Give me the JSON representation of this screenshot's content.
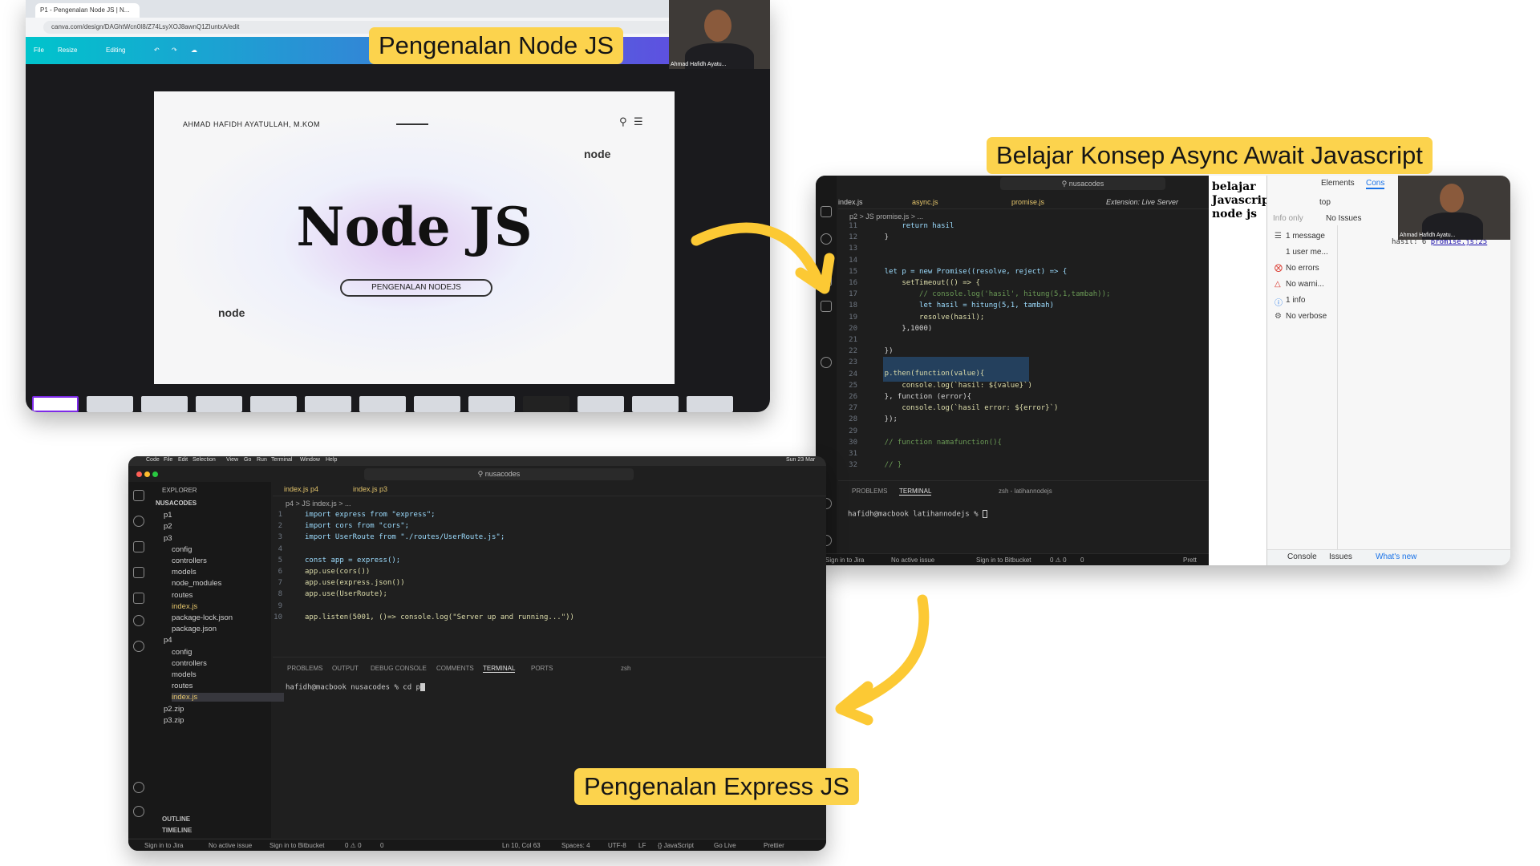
{
  "labels": {
    "node": "Pengenalan Node JS",
    "async": "Belajar Konsep Async Await Javascript",
    "express": "Pengenalan Express JS"
  },
  "colors": {
    "label_bg": "#fcd34d",
    "arrow": "#fcc934",
    "canva_toolbar_start": "#00c4cc",
    "canva_toolbar_end": "#6c3fe3"
  },
  "canva": {
    "tab_title": "P1 - Pengenalan Node JS | N...",
    "url": "canva.com/design/DAGhtWcn0I8/Z74LsyXOJ8awnQ1ZIuntxA/edit",
    "toolbar": {
      "file": "File",
      "resize": "Resize",
      "editing": "Editing"
    },
    "cam_name": "Ahmad Hafidh Ayatu...",
    "slide": {
      "author": "AHMAD HAFIDH AYATULLAH, M.KOM",
      "title": "Node JS",
      "button": "PENGENALAN NODEJS",
      "logo": "node"
    }
  },
  "vs_top": {
    "search": "nusacodes",
    "tabs": [
      "index.js",
      "async.js",
      "promise.js",
      "Extension: Live Server"
    ],
    "breadcrumb": "p2 > JS promise.js > ...",
    "line_numbers": [
      "11",
      "12",
      "13",
      "14",
      "15",
      "16",
      "17",
      "18",
      "19",
      "20",
      "21",
      "22",
      "23",
      "24",
      "25",
      "26",
      "27",
      "28",
      "29",
      "30",
      "31",
      "32"
    ],
    "code": [
      "        return hasil",
      "    }",
      "",
      "",
      "    let p = new Promise((resolve, reject) => {",
      "        setTimeout(() => {",
      "            // console.log('hasil', hitung(5,1,tambah));",
      "            let hasil = hitung(5,1, tambah)",
      "            resolve(hasil);",
      "        },1000)",
      "",
      "    })",
      "",
      "    p.then(function(value){",
      "        console.log(`hasil: ${value}`)",
      "    }, function (error){",
      "        console.log(`hasil error: ${error}`)",
      "    });",
      "",
      "    // function namafunction(){",
      "",
      "    // }"
    ],
    "panel_tabs": [
      "PROBLEMS",
      "TERMINAL"
    ],
    "terminal_name": "zsh - latihannodejs",
    "terminal_prompt": "hafidh@macbook latihannodejs % ",
    "status": [
      "Sign in to Jira",
      "No active issue",
      "Sign in to Bitbucket",
      "0 ⚠ 0",
      "0",
      "Prett"
    ],
    "cam_name": "Ahmad Hafidh Ayatu..."
  },
  "devtools": {
    "page_text": [
      "belajar",
      "Javascript",
      "node js"
    ],
    "tabs": [
      "Elements",
      "Cons"
    ],
    "context": "top",
    "filter": "Info only",
    "issues": "No Issues",
    "sidebar": [
      "1 message",
      "1 user me...",
      "No errors",
      "No warni...",
      "1 info",
      "No verbose"
    ],
    "log_text": "hasil: 6",
    "log_link": "promise.js:25",
    "drawer_tabs": [
      "Console",
      "Issues",
      "What's new"
    ]
  },
  "vs_bottom": {
    "menubar": [
      "Code",
      "File",
      "Edit",
      "Selection",
      "View",
      "Go",
      "Run",
      "Terminal",
      "Window",
      "Help"
    ],
    "menubar_time": "Sun 23 Mar",
    "search": "nusacodes",
    "explorer_title": "EXPLORER",
    "tree": [
      {
        "t": "NUSACODES",
        "d": 0
      },
      {
        "t": "p1",
        "d": 1
      },
      {
        "t": "p2",
        "d": 1
      },
      {
        "t": "p3",
        "d": 1
      },
      {
        "t": "config",
        "d": 2
      },
      {
        "t": "controllers",
        "d": 2
      },
      {
        "t": "models",
        "d": 2
      },
      {
        "t": "node_modules",
        "d": 2
      },
      {
        "t": "routes",
        "d": 2
      },
      {
        "t": "index.js",
        "d": 2
      },
      {
        "t": "package-lock.json",
        "d": 2
      },
      {
        "t": "package.json",
        "d": 2
      },
      {
        "t": "p4",
        "d": 1
      },
      {
        "t": "config",
        "d": 2
      },
      {
        "t": "controllers",
        "d": 2
      },
      {
        "t": "models",
        "d": 2
      },
      {
        "t": "routes",
        "d": 2
      },
      {
        "t": "index.js",
        "d": 2
      },
      {
        "t": "p2.zip",
        "d": 1
      },
      {
        "t": "p3.zip",
        "d": 1
      }
    ],
    "outline": "OUTLINE",
    "timeline": "TIMELINE",
    "tabs": [
      "index.js p4",
      "index.js p3"
    ],
    "breadcrumb": "p4 > JS index.js > ...",
    "line_numbers": [
      "1",
      "2",
      "3",
      "4",
      "5",
      "6",
      "7",
      "8",
      "9",
      "10"
    ],
    "code": [
      "import express from \"express\";",
      "import cors from \"cors\";",
      "import UserRoute from \"./routes/UserRoute.js\";",
      "",
      "const app = express();",
      "app.use(cors())",
      "app.use(express.json())",
      "app.use(UserRoute);",
      "",
      "app.listen(5001, ()=> console.log(\"Server up and running...\"))"
    ],
    "panel_tabs": [
      "PROBLEMS",
      "OUTPUT",
      "DEBUG CONSOLE",
      "COMMENTS",
      "TERMINAL",
      "PORTS"
    ],
    "terminal_name": "zsh",
    "terminal_line": "hafidh@macbook nusacodes % cd p",
    "status": [
      "Sign in to Jira",
      "No active issue",
      "Sign in to Bitbucket",
      "0 ⚠ 0",
      "0",
      "Ln 10, Col 63",
      "Spaces: 4",
      "UTF-8",
      "LF",
      "{} JavaScript",
      "Go Live",
      "Prettier"
    ]
  }
}
